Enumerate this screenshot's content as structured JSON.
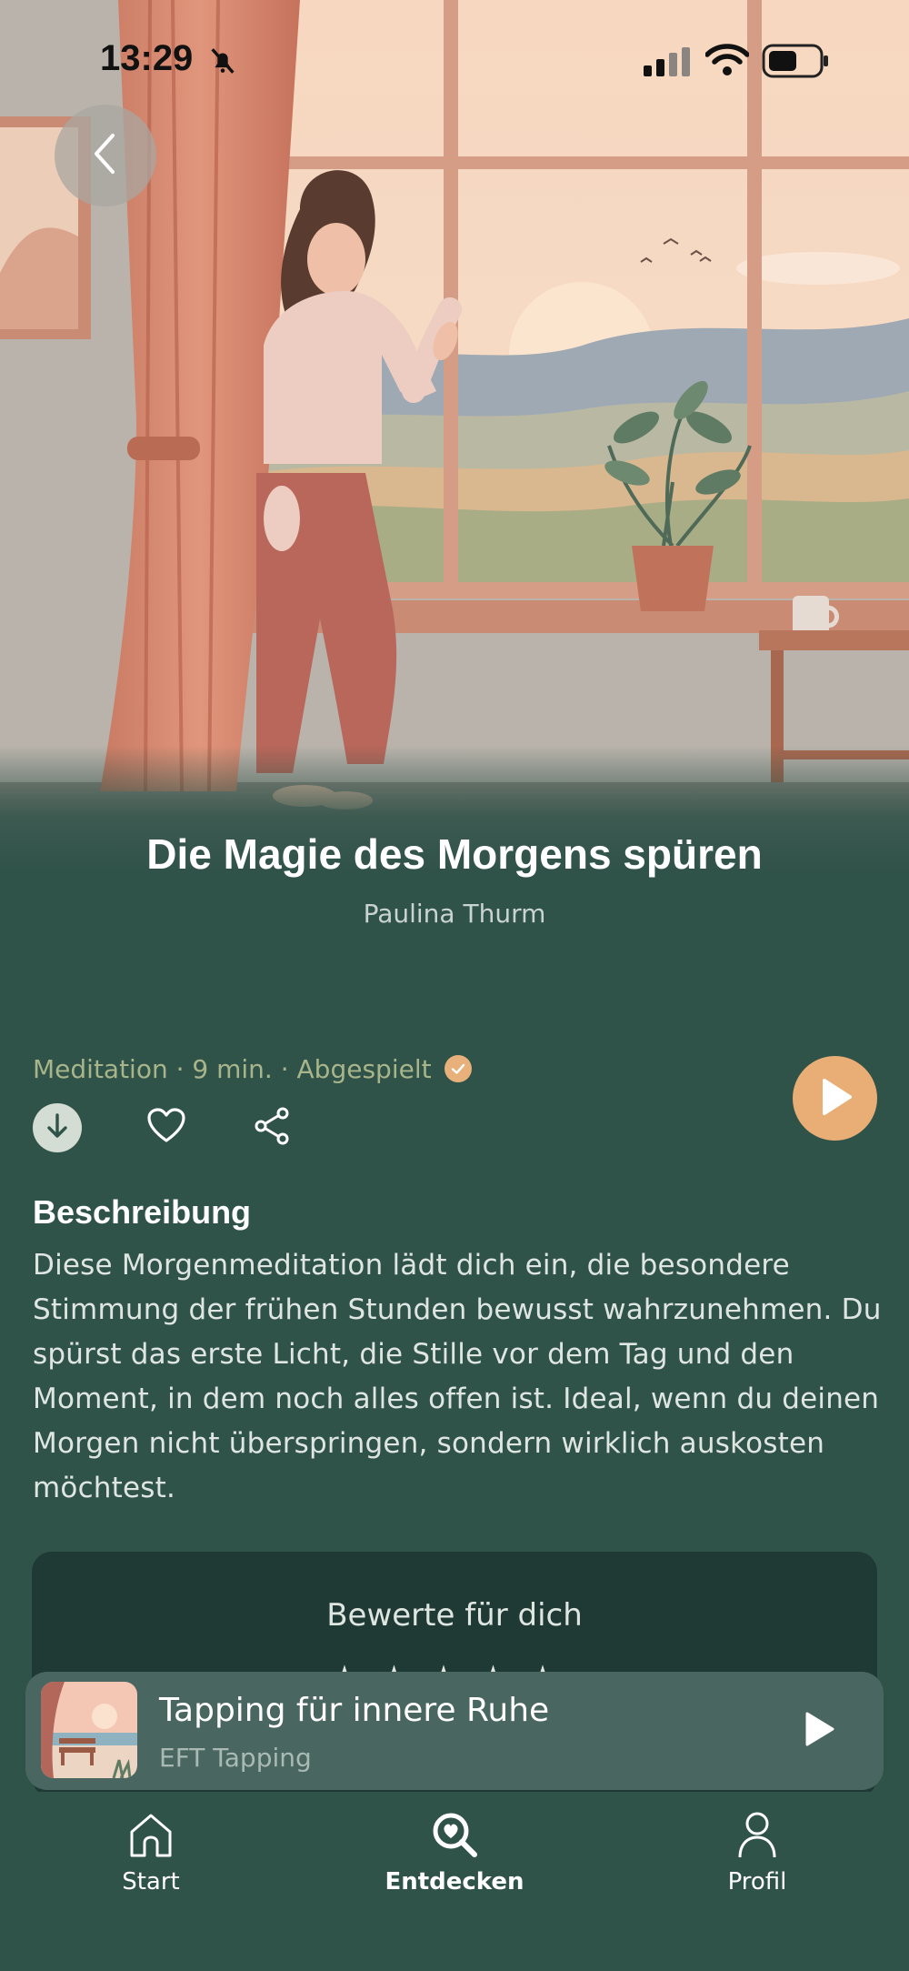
{
  "status_bar": {
    "time": "13:29"
  },
  "hero": {
    "image": "woman-at-morning-window-illustration"
  },
  "header": {
    "back_icon": "chevron-left-icon"
  },
  "track": {
    "title": "Die Magie des Morgens spüren",
    "author": "Paulina Thurm",
    "meta": "Meditation · 9 min. · Abgespielt",
    "played": true
  },
  "actions": {
    "download_icon": "download-icon",
    "like_icon": "heart-icon",
    "share_icon": "share-icon",
    "play_icon": "play-icon"
  },
  "description": {
    "heading": "Beschreibung",
    "text": "Diese Morgenmeditation lädt dich ein, die besondere Stimmung der frühen Stunden bewusst wahrzunehmen. Du spürst das erste Licht, die Stille vor dem Tag und den Moment, in dem noch alles offen ist. Ideal, wenn du deinen Morgen nicht überspringen, sondern wirklich auskosten möchtest."
  },
  "rating": {
    "title": "Bewerte für dich",
    "stars": "★★★★★",
    "value": 0
  },
  "mini_player": {
    "title": "Tapping für innere Ruhe",
    "subtitle": "EFT Tapping",
    "play_icon": "play-icon"
  },
  "tab_bar": {
    "tabs": [
      {
        "label": "Start",
        "icon": "home-icon",
        "active": false
      },
      {
        "label": "Entdecken",
        "icon": "discover-search-icon",
        "active": true
      },
      {
        "label": "Profil",
        "icon": "person-icon",
        "active": false
      }
    ]
  },
  "colors": {
    "background": "#2f5249",
    "accent": "#e9ad76",
    "meta_text": "#a8b58a",
    "card": "#1f3a34",
    "mini_player": "#4a6660"
  }
}
